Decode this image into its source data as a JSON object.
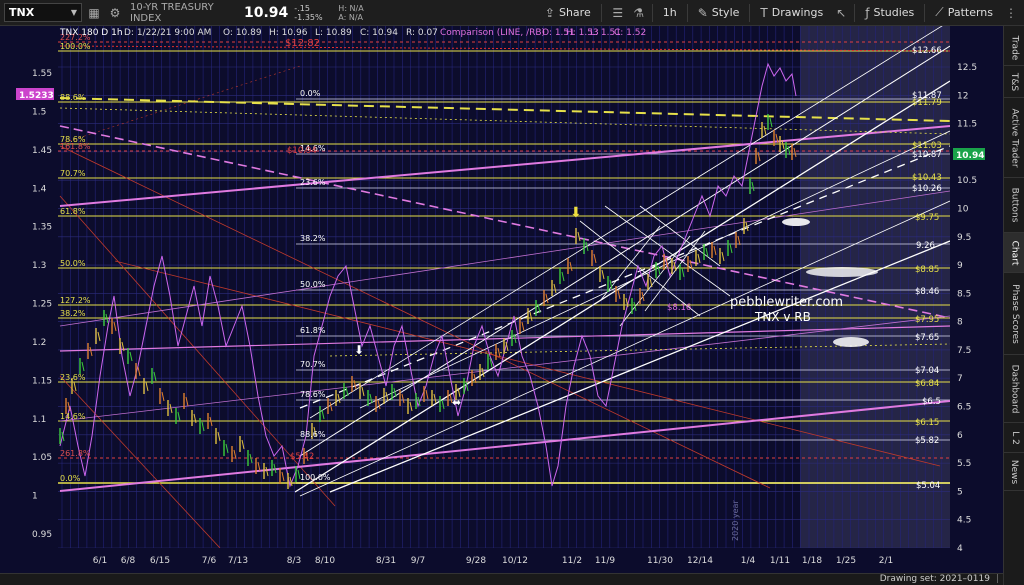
{
  "toolbar": {
    "symbol": "TNX",
    "symbol_name": "10-YR TREASURY INDEX",
    "last": "10.94",
    "change": "-.15",
    "change_pct": "-1.35%",
    "high_label": "H: N/A",
    "ask_label": "A: N/A",
    "share_label": "Share",
    "interval_label": "1h",
    "style_label": "Style",
    "drawings_label": "Drawings",
    "studies_label": "Studies",
    "patterns_label": "Patterns",
    "icons": [
      "chevron-down-icon",
      "grid-icon",
      "gear-icon",
      "share-icon",
      "list-icon",
      "flask-icon",
      "pencil-icon",
      "ruler-icon",
      "cursor-icon",
      "studies-icon",
      "patterns-icon",
      "kebab-icon"
    ]
  },
  "legend": {
    "title": "TNX 180 D 1h",
    "date": "D: 1/22/21 9:00 AM",
    "open": "O: 10.89",
    "high": "H: 10.96",
    "low": "L: 10.89",
    "close": "C: 10.94",
    "range": "R: 0.07",
    "comparison_label": "Comparison (LINE, /RB)",
    "cmp_open": "O: 1.51",
    "cmp_high": "H: 1.53",
    "cmp_low": "L: 1.51",
    "cmp_close": "C: 1.52"
  },
  "right_axis": {
    "ticks": [
      "12.5",
      "12",
      "11.5",
      "11",
      "10.5",
      "10",
      "9.5",
      "9",
      "8.5",
      "8",
      "7.5",
      "7",
      "6.5",
      "6",
      "5.5",
      "5",
      "4.5",
      "4"
    ],
    "current_price": "10.94"
  },
  "left_axis": {
    "ticks": [
      "1.55",
      "1.5",
      "1.45",
      "1.4",
      "1.35",
      "1.3",
      "1.25",
      "1.2",
      "1.15",
      "1.1",
      "1.05",
      "1",
      "0.95"
    ],
    "current_value": "1.5233"
  },
  "x_axis": {
    "ticks": [
      "6/1",
      "6/8",
      "6/15",
      "7/6",
      "7/13",
      "8/3",
      "8/10",
      "8/31",
      "9/7",
      "9/28",
      "10/12",
      "11/2",
      "11/9",
      "11/30",
      "12/14",
      "1/4",
      "1/11",
      "1/18",
      "1/25",
      "2/1"
    ],
    "year_marker": "2020 year"
  },
  "price_levels": [
    "$12.66",
    "$11.87",
    "$11.79",
    "$11.03",
    "$10.87",
    "$10.43",
    "$10.26",
    "$9.75",
    "9.26",
    "$8.85",
    "$8.46",
    "$7.95",
    "$7.65",
    "$7.04",
    "$6.84",
    "$6.5",
    "$6.15",
    "$5.82",
    "$5.04",
    "$8.16",
    "$12.82",
    "$10.94",
    "$5.42"
  ],
  "fib_right": [
    "0.0%",
    "14.6%",
    "23.6%",
    "38.2%",
    "50.0%",
    "61.8%",
    "70.7%",
    "78.6%",
    "88.6%",
    "100.0%"
  ],
  "fib_left": [
    "100.0%",
    "88.6%",
    "78.6%",
    "70.7%",
    "61.8%",
    "50.0%",
    "38.2%",
    "23.6%",
    "14.6%",
    "0.0%",
    "127.2%",
    "161.8%",
    "261.8%",
    "227.2%"
  ],
  "watermark": {
    "line1": "pebblewriter.com",
    "line2": "TNX v RB"
  },
  "side_tabs": [
    "Trade",
    "T&S",
    "Active Trader",
    "Buttons",
    "Chart",
    "Phase Scores",
    "Dashboard",
    "L 2",
    "News"
  ],
  "bottom": {
    "drawing_set": "Drawing set: 2021–0119",
    "sep_icon": "divider"
  },
  "colors": {
    "background": "#0c0c2c",
    "grid": "#2a2a7a",
    "fib_yellow": "#e6e04a",
    "trend_pink": "#e07ae0",
    "channel_white": "#ffffff",
    "ma_red": "#c0392b",
    "comparison": "#cc66ee"
  }
}
